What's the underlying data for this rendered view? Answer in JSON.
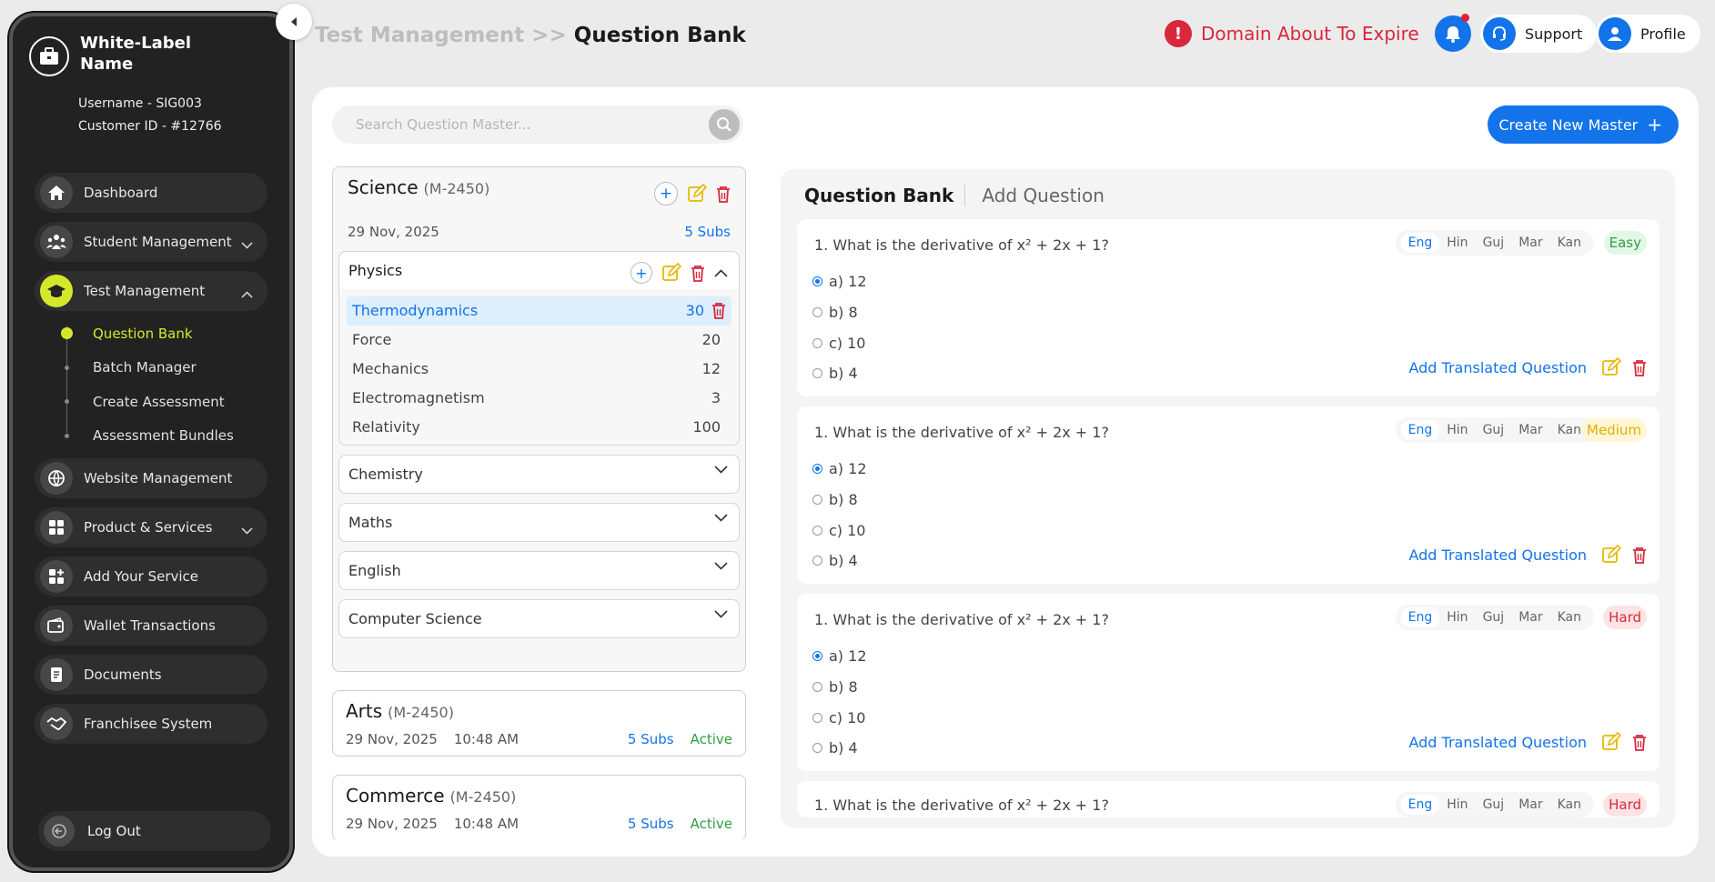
{
  "brand": {
    "name": "White-Label Name",
    "username": "Username - SIG003",
    "customer_id": "Customer ID - #12766"
  },
  "nav": {
    "dashboard": "Dashboard",
    "student_management": "Student Management",
    "test_management": "Test Management",
    "test_sub": {
      "question_bank": "Question Bank",
      "batch_manager": "Batch Manager",
      "create_assessment": "Create Assessment",
      "assessment_bundles": "Assessment Bundles"
    },
    "website_management": "Website Management",
    "product_services": "Product & Services",
    "add_service": "Add Your Service",
    "wallet": "Wallet Transactions",
    "documents": "Documents",
    "franchisee": "Franchisee System",
    "logout": "Log Out"
  },
  "header": {
    "crumb_parent": "Test Management >>",
    "crumb_current": "Question Bank",
    "domain_warning": "Domain About To Expire",
    "warning_glyph": "!",
    "support": "Support",
    "profile": "Profile"
  },
  "search": {
    "placeholder": "Search Question Master..."
  },
  "create_button": {
    "label": "Create New Master",
    "plus": "+"
  },
  "masters": {
    "science": {
      "title": "Science",
      "code": "(M-2450)",
      "date": "29 Nov, 2025",
      "subs": "5 Subs",
      "subjects": {
        "physics": {
          "name": "Physics",
          "topics": [
            {
              "name": "Thermodynamics",
              "count": "30"
            },
            {
              "name": "Force",
              "count": "20"
            },
            {
              "name": "Mechanics",
              "count": "12"
            },
            {
              "name": "Electromagnetism",
              "count": "3"
            },
            {
              "name": "Relativity",
              "count": "100"
            }
          ]
        },
        "chemistry": "Chemistry",
        "maths": "Maths",
        "english": "English",
        "computer_science": "Computer Science"
      }
    },
    "arts": {
      "title": "Arts",
      "code": "(M-2450)",
      "date": "29 Nov, 2025",
      "time": "10:48 AM",
      "subs": "5 Subs",
      "status": "Active"
    },
    "commerce": {
      "title": "Commerce",
      "code": "(M-2450)",
      "date": "29 Nov, 2025",
      "time": "10:48 AM",
      "subs": "5 Subs",
      "status": "Active"
    }
  },
  "tabs": {
    "question_bank": "Question Bank",
    "add_question": "Add Question"
  },
  "plus_glyph": "+",
  "languages": [
    "Eng",
    "Hin",
    "Guj",
    "Mar",
    "Kan"
  ],
  "add_translated": "Add Translated Question",
  "questions": [
    {
      "text": "1. What is the derivative of x² + 2x + 1?",
      "options": [
        "a) 12",
        "b) 8",
        "c) 10",
        "b) 4"
      ],
      "difficulty": "Easy",
      "difficulty_color": "#2f9e44",
      "difficulty_bg": "#e3f7e6"
    },
    {
      "text": "1. What is the derivative of x² + 2x + 1?",
      "options": [
        "a) 12",
        "b) 8",
        "c) 10",
        "b) 4"
      ],
      "difficulty": "Medium",
      "difficulty_color": "#e0b000",
      "difficulty_bg": "#fff6d6"
    },
    {
      "text": "1. What is the derivative of x² + 2x + 1?",
      "options": [
        "a) 12",
        "b) 8",
        "c) 10",
        "b) 4"
      ],
      "difficulty": "Hard",
      "difficulty_color": "#d8283c",
      "difficulty_bg": "#fde3e3"
    },
    {
      "text": "1. What is the derivative of x² + 2x + 1?",
      "difficulty": "Hard"
    }
  ],
  "colors": {
    "accent": "#1273ea",
    "lime": "#d4e82a",
    "danger": "#d8283c",
    "edit": "#e6b800"
  }
}
